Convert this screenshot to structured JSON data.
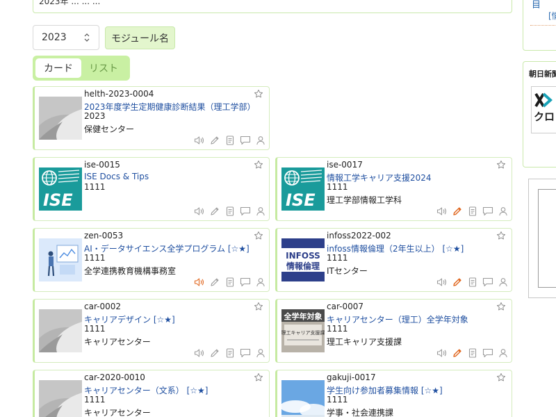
{
  "top_box": {
    "clipped_text": "2023年 ...  ...  ..."
  },
  "year_select": {
    "value": "2023"
  },
  "module_label": "モジュール名",
  "view_toggle": {
    "card_label": "カード",
    "list_label": "リスト"
  },
  "cards": [
    {
      "id": "helth-2023-0004",
      "title": "2023年度学生定期健康診断結果（理工学部）",
      "year": "2023",
      "owner": "保健センター",
      "thumb": "default-thumbnail",
      "audio_active": false,
      "edit_active": false
    },
    {
      "id": "ise-0015",
      "title": "ISE Docs & Tips",
      "year": "1111",
      "owner": "",
      "thumb": "ise-logo",
      "audio_active": false,
      "edit_active": false
    },
    {
      "id": "ise-0017",
      "title": "情報工学キャリア支援2024",
      "year": "1111",
      "owner": "理工学部情報工学科",
      "thumb": "ise-logo",
      "audio_active": false,
      "edit_active": true
    },
    {
      "id": "zen-0053",
      "title": "AI・データサイエンス全学プログラム [☆★]",
      "year": "1111",
      "owner": "全学連携教育機構事務室",
      "thumb": "ai-illustration",
      "audio_active": true,
      "edit_active": false
    },
    {
      "id": "infoss2022-002",
      "title": "infoss情報倫理（2年生以上） [☆★]",
      "year": "1111",
      "owner": "ITセンター",
      "thumb": "infoss-logo",
      "audio_active": false,
      "edit_active": true
    },
    {
      "id": "car-0002",
      "title": "キャリアデザイン [☆★]",
      "year": "1111",
      "owner": "キャリアセンター",
      "thumb": "default-thumbnail",
      "audio_active": false,
      "edit_active": false
    },
    {
      "id": "car-0007",
      "title": "キャリアセンター（理工）全学年対象",
      "year": "1111",
      "owner": "理工キャリア支援課",
      "thumb": "career-photo",
      "audio_active": false,
      "edit_active": true
    },
    {
      "id": "car-2020-0010",
      "title": "キャリアセンター（文系） [☆★]",
      "year": "1111",
      "owner": "キャリアセンター",
      "thumb": "default-thumbnail",
      "audio_active": false,
      "edit_active": false
    },
    {
      "id": "gakuji-0017",
      "title": "学生向け参加者募集情報 [☆★]",
      "year": "1111",
      "owner": "学事・社会連携課",
      "thumb": "sky-photo",
      "audio_active": false,
      "edit_active": false
    }
  ],
  "thumb_texts": {
    "ise": "ISE",
    "infoss_top": "INFOSS",
    "infoss_bottom": "情報倫理",
    "career_top": "全学年対象",
    "career_mid": "理工キャリア支援課"
  },
  "right_column": {
    "link_icon_text": "目",
    "link_text": "[情",
    "news_heading": "朝日新聞",
    "logo_text": "クロ"
  },
  "colors": {
    "accent_green": "#c6eaa1",
    "link_blue": "#1f4fa0",
    "active_orange": "#e0661e",
    "icon_gray": "#9a9a9a"
  }
}
